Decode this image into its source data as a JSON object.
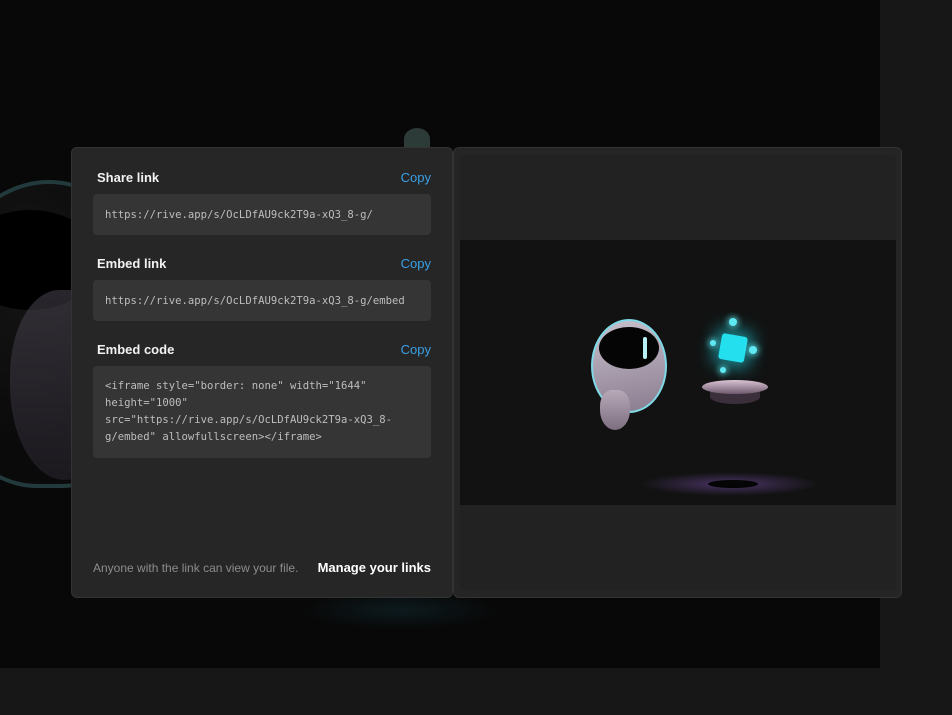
{
  "share": {
    "share_link": {
      "title": "Share link",
      "copy_label": "Copy",
      "value": "https://rive.app/s/OcLDfAU9ck2T9a-xQ3_8-g/"
    },
    "embed_link": {
      "title": "Embed link",
      "copy_label": "Copy",
      "value": "https://rive.app/s/OcLDfAU9ck2T9a-xQ3_8-g/embed"
    },
    "embed_code": {
      "title": "Embed code",
      "copy_label": "Copy",
      "value": "<iframe style=\"border: none\" width=\"1644\" height=\"1000\" src=\"https://rive.app/s/OcLDfAU9ck2T9a-xQ3_8-g/embed\" allowfullscreen></iframe>"
    },
    "footer_note": "Anyone with the link can view your file.",
    "manage_label": "Manage your links"
  },
  "colors": {
    "accent": "#3aa0e6",
    "panel": "#262626",
    "field": "#353535",
    "cube_glow": "#24e0ef"
  },
  "icons": {
    "preview": "robot-animation-preview"
  }
}
